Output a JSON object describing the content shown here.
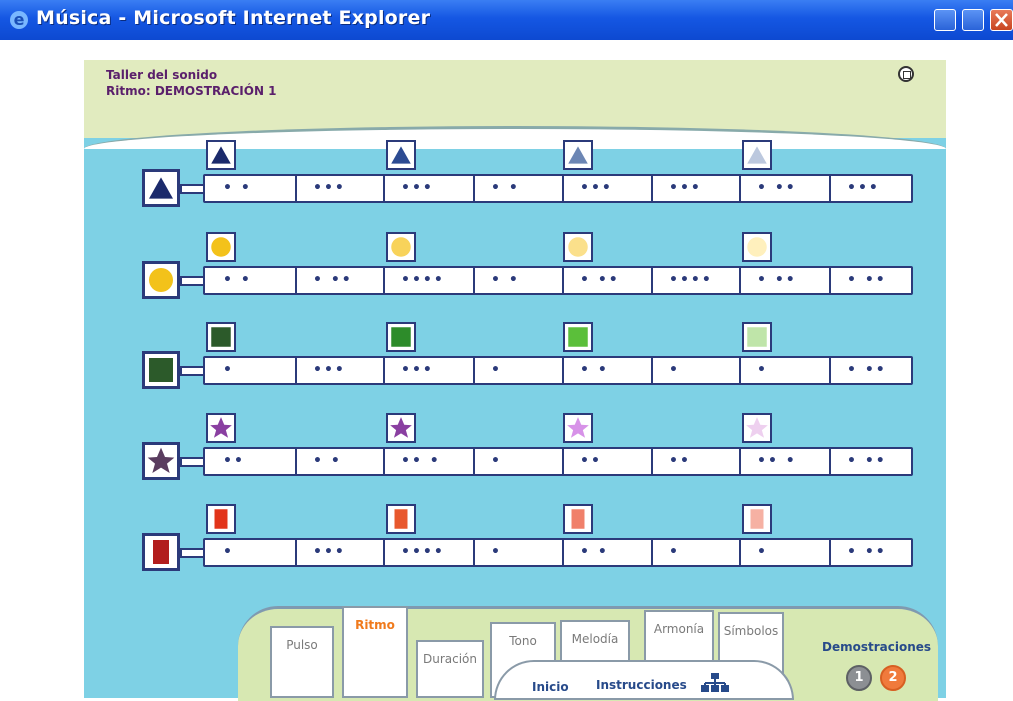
{
  "window": {
    "title": "Música - Microsoft Internet Explorer"
  },
  "header": {
    "title": "Taller del sonido",
    "subtitle": "Ritmo: DEMOSTRACIÓN 1"
  },
  "rows": [
    {
      "name": "triangle",
      "color": "#1b2a6b",
      "levels": [
        "#1b2a6b",
        "#2c4b92",
        "#6c86b4",
        "#bcc8de"
      ],
      "segments": [
        "•  •",
        "•••",
        "•••",
        "•  •",
        "•••",
        "•••",
        "•  ••",
        "•••"
      ]
    },
    {
      "name": "circle",
      "color": "#f3c21a",
      "levels": [
        "#f3c21a",
        "#f8d35a",
        "#fbe08b",
        "#fff0bd"
      ],
      "segments": [
        "•  •",
        "•  ••",
        "••••",
        "•  •",
        "•  ••",
        "••••",
        "•  ••",
        "•  ••"
      ]
    },
    {
      "name": "square",
      "color": "#2c5a2a",
      "levels": [
        "#2c5a2a",
        "#2d8c2a",
        "#5bbf3a",
        "#bfe5a9"
      ],
      "segments": [
        "•",
        "•••",
        "•••",
        "•",
        "•  •",
        "•",
        "•",
        "•  ••"
      ]
    },
    {
      "name": "star",
      "color": "#5a3c5f",
      "levels": [
        "#8a3fa1",
        "#8a3fa1",
        "#d792e8",
        "#eed0ef"
      ],
      "segments": [
        "••",
        "•  •",
        "••  •",
        "•",
        "••",
        "••",
        "••  •",
        "•  ••"
      ]
    },
    {
      "name": "rectangle",
      "color": "#b21d1d",
      "levels": [
        "#e2341a",
        "#e8582d",
        "#f0806a",
        "#f6b1a3"
      ],
      "segments": [
        "•",
        "•••",
        "••••",
        "•",
        "•  •",
        "•",
        "•",
        "•  ••"
      ]
    }
  ],
  "nav": {
    "tabs": [
      "Pulso",
      "Ritmo",
      "Duración",
      "Tono",
      "Melodía",
      "Armonía",
      "Símbolos"
    ],
    "active_tab": "Ritmo",
    "bottom": [
      "Inicio",
      "Instrucciones"
    ],
    "demos_label": "Demostraciones",
    "demo_buttons": [
      "1",
      "2"
    ]
  }
}
